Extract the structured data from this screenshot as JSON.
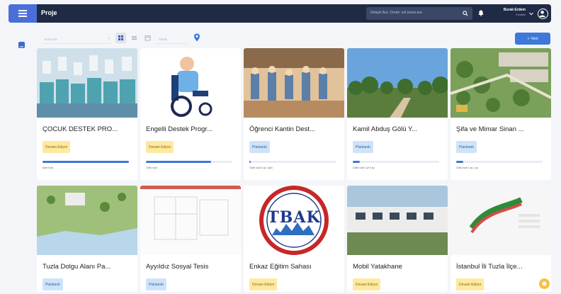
{
  "header": {
    "title": "Proje",
    "search_placeholder": "Detaylı Ara, Örnek: sol sonra ara",
    "user_name": "Burak Erdem",
    "user_role": "Yönetici"
  },
  "toolbar": {
    "search_placeholder": "Hızlı Ara",
    "filter_placeholder": "Tümü",
    "new_button": "+ Yeni"
  },
  "colors": {
    "topbar": "#1f2a44",
    "accent": "#3e78d8",
    "status_yellow": "#fde9a0",
    "status_blue": "#cfe3f8"
  },
  "cards": [
    {
      "title": "ÇOCUK DESTEK PRO...",
      "status": "Devam Ediyor",
      "status_color": "yellow",
      "progress": 1.0,
      "progress_text": "Adet Kalo"
    },
    {
      "title": "Engelli Destek Progr...",
      "status": "Devam Ediyor",
      "status_color": "yellow",
      "progress": 0.75,
      "progress_text": "Güllü sadi"
    },
    {
      "title": "Öğrenci Kantin Dest...",
      "status": "Planlandı",
      "status_color": "blue",
      "progress": 0.02,
      "progress_text": "Güllü sadi 3 ay 1 gün"
    },
    {
      "title": "Kamil Abduş Gölü Y...",
      "status": "Planlandı",
      "status_color": "blue",
      "progress": 0.08,
      "progress_text": "Güllü sadi 1 yıl 8 ay"
    },
    {
      "title": "Şifa ve Mimar Sinan ...",
      "status": "Planlandı",
      "status_color": "blue",
      "progress": 0.08,
      "progress_text": "Güllü sadi 1 ay 1 ay"
    },
    {
      "title": "Tuzla Dolgu Alanı Pa...",
      "status": "Planlandı",
      "status_color": "blue"
    },
    {
      "title": "Ayyıldız Sosyal Tesis",
      "status": "Planlandı",
      "status_color": "blue"
    },
    {
      "title": "Enkaz Eğitim Sahası",
      "status": "Devam Ediyor",
      "status_color": "yellow"
    },
    {
      "title": "Mobil Yatakhane",
      "status": "Devam Ediyor",
      "status_color": "yellow"
    },
    {
      "title": "İstanbul İli Tuzla İlçe...",
      "status": "Devam Ediyor",
      "status_color": "yellow"
    }
  ],
  "logo_text": "TBAK"
}
